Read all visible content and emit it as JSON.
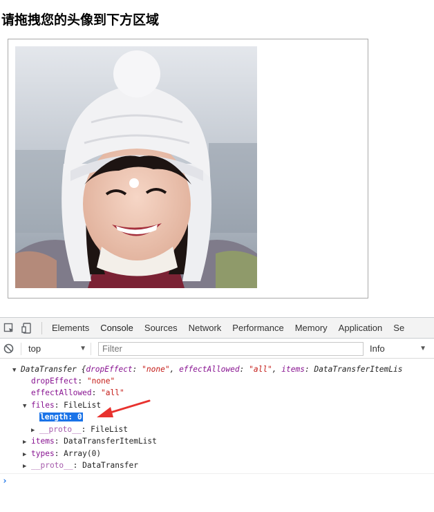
{
  "page": {
    "title": "请拖拽您的头像到下方区域"
  },
  "devtools": {
    "tabs": [
      {
        "label": "Elements",
        "active": false
      },
      {
        "label": "Console",
        "active": true
      },
      {
        "label": "Sources",
        "active": false
      },
      {
        "label": "Network",
        "active": false
      },
      {
        "label": "Performance",
        "active": false
      },
      {
        "label": "Memory",
        "active": false
      },
      {
        "label": "Application",
        "active": false
      },
      {
        "label": "Se",
        "active": false
      }
    ],
    "context": "top",
    "filter_placeholder": "Filter",
    "level": "Info",
    "accent": "#1a73e8"
  },
  "console": {
    "summary": {
      "name": "DataTransfer",
      "open": " {",
      "k1": "dropEffect",
      "v1": "\"none\"",
      "k2": "effectAllowed",
      "v2": "\"all\"",
      "k3": "items",
      "v3": "DataTransferItemLis"
    },
    "dropEffect": {
      "key": "dropEffect",
      "value": "\"none\""
    },
    "effectAllowed": {
      "key": "effectAllowed",
      "value": "\"all\""
    },
    "files": {
      "key": "files",
      "value": "FileList"
    },
    "length": {
      "label": "length: 0"
    },
    "files_proto": {
      "key": "__proto__",
      "value": "FileList"
    },
    "items": {
      "key": "items",
      "value": "DataTransferItemList"
    },
    "types": {
      "key": "types",
      "value": "Array(0)"
    },
    "proto": {
      "key": "__proto__",
      "value": "DataTransfer"
    },
    "prompt": "›"
  },
  "annotation": {
    "arrow_color": "#e8322e"
  }
}
